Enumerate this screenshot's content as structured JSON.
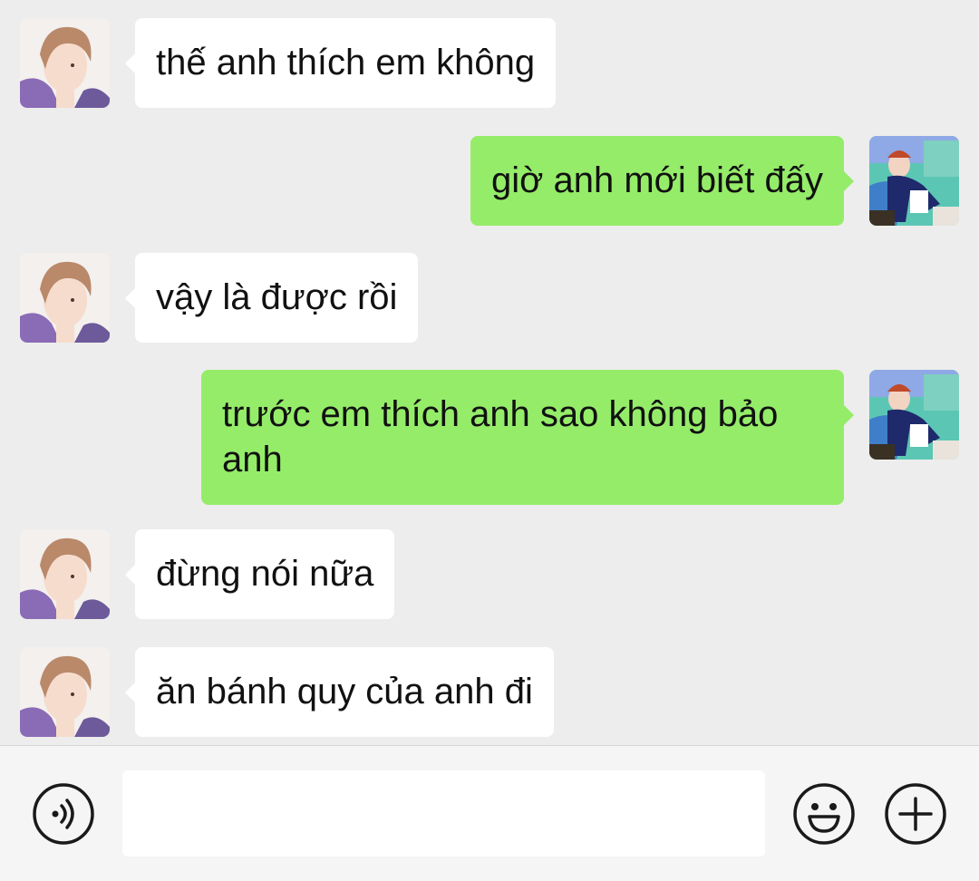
{
  "messages": [
    {
      "side": "left",
      "text": "thế anh thích em không",
      "avatar": "avatar-contact"
    },
    {
      "side": "right",
      "text": "giờ anh mới biết đấy",
      "avatar": "avatar-self"
    },
    {
      "side": "left",
      "text": "vậy là được rồi",
      "avatar": "avatar-contact"
    },
    {
      "side": "right",
      "text": "trước em thích anh sao không bảo anh",
      "avatar": "avatar-self"
    },
    {
      "side": "left",
      "text": "đừng nói nữa",
      "avatar": "avatar-contact"
    },
    {
      "side": "left",
      "text": "ăn bánh quy của anh đi",
      "avatar": "avatar-contact"
    }
  ],
  "input": {
    "value": "",
    "placeholder": ""
  },
  "icons": {
    "voice": "voice-icon",
    "emoji": "emoji-icon",
    "add": "plus-icon"
  },
  "colors": {
    "background": "#ededed",
    "incoming_bubble": "#ffffff",
    "outgoing_bubble": "#95ec69",
    "input_bar": "#f5f5f5",
    "icon": "#1a1a1a"
  }
}
